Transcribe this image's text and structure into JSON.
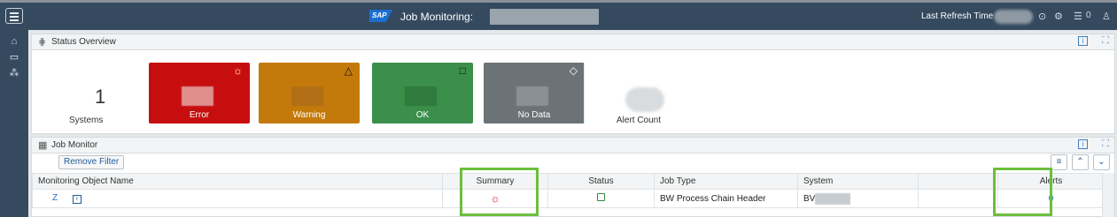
{
  "header": {
    "logo_text": "SAP",
    "title": "Job Monitoring:",
    "refresh_label": "Last Refresh Time : 1",
    "alerts_count": "0"
  },
  "status_panel": {
    "title": "Status Overview",
    "systems_count": "1",
    "systems_label": "Systems",
    "tiles": [
      {
        "label": "Error",
        "color": "#c70e0e",
        "icon": "error-icon"
      },
      {
        "label": "Warning",
        "color": "#c47a0b",
        "icon": "warning-icon"
      },
      {
        "label": "OK",
        "color": "#3b8f4a",
        "icon": "ok-icon"
      },
      {
        "label": "No Data",
        "color": "#6c7377",
        "icon": "nodata-icon"
      }
    ],
    "alert_count_label": "Alert Count"
  },
  "job_panel": {
    "title": "Job Monitor",
    "remove_filter_label": "Remove Filter",
    "columns": [
      "Monitoring Object Name",
      "Summary",
      "Status",
      "Job Type",
      "System",
      "",
      "Alerts"
    ],
    "rows": [
      {
        "name": "Z",
        "summary_icon": "error-icon",
        "status_icon": "ok-icon",
        "job_type": "BW Process Chain Header",
        "system": "BV",
        "alerts": "0"
      }
    ]
  },
  "colors": {
    "shell": "#354a5f",
    "highlight": "#6bbf3e"
  }
}
